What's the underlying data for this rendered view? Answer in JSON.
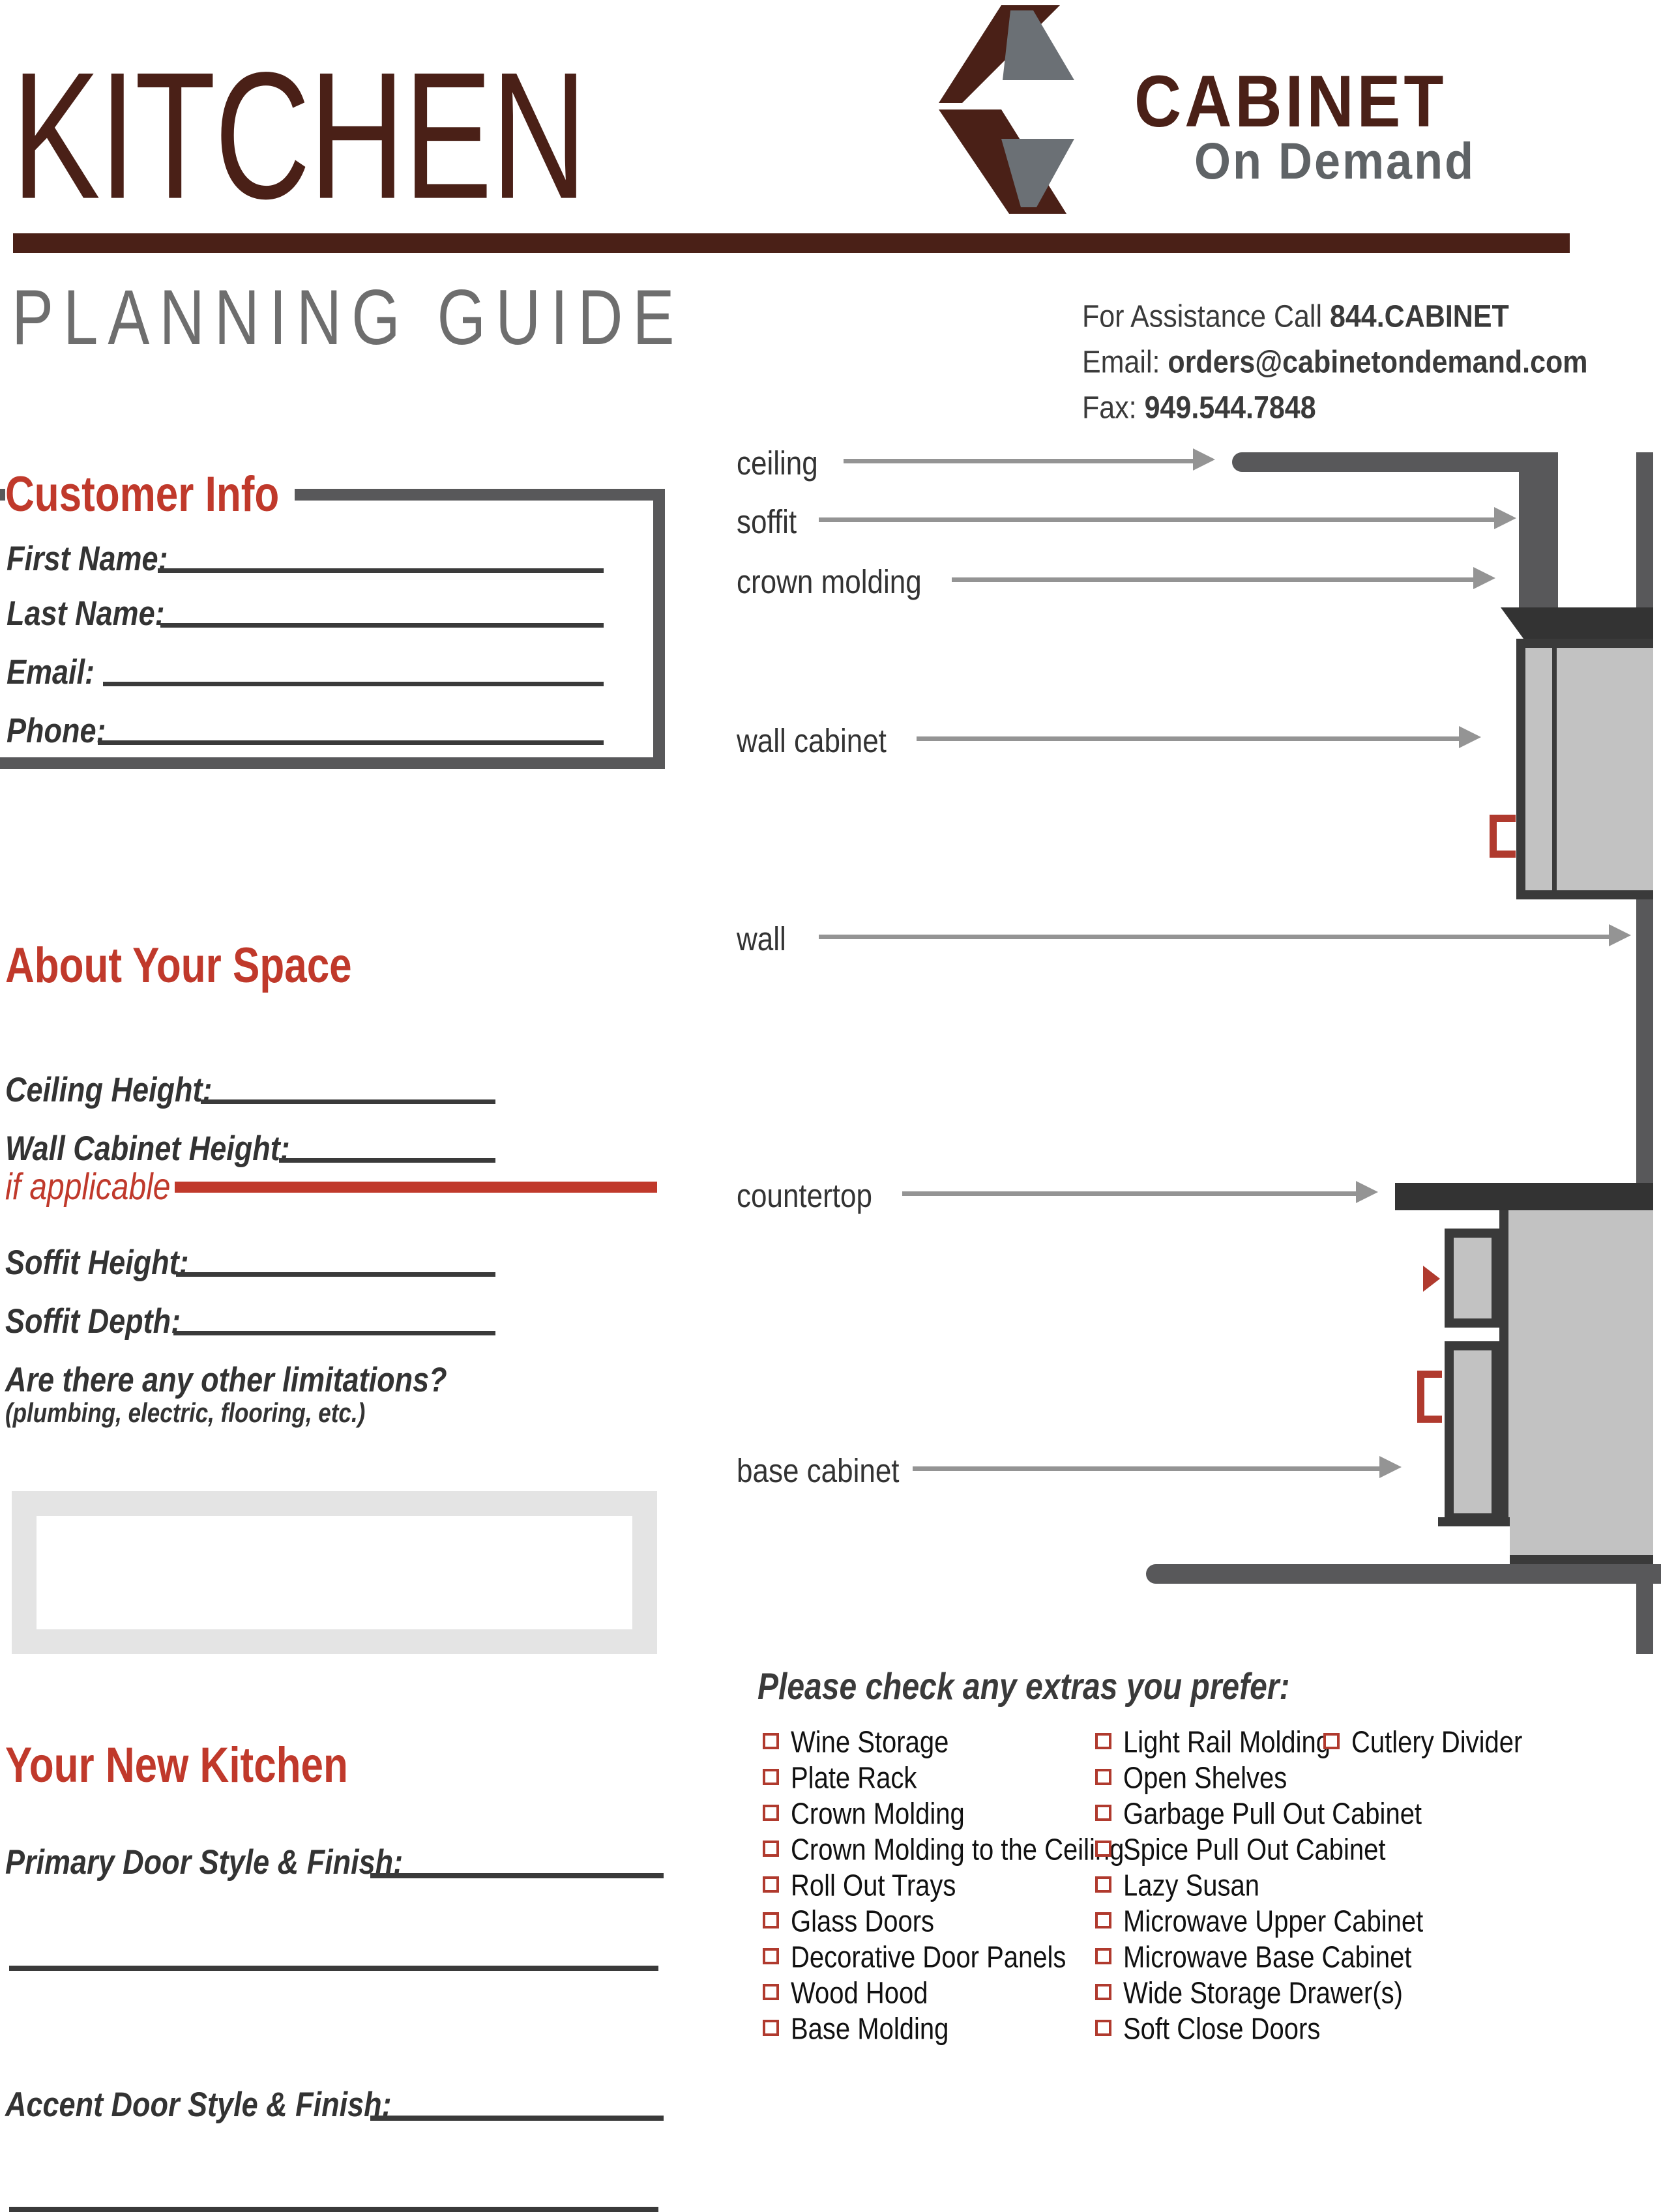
{
  "header": {
    "title": "KITCHEN",
    "subtitle": "PLANNING GUIDE",
    "logo": {
      "word_primary": "CABINET",
      "word_secondary": "On Demand"
    },
    "contact": {
      "phone_prefix": "For Assistance Call ",
      "phone": "844.CABINET",
      "email_prefix": "Email: ",
      "email": "orders@cabinetondemand.com",
      "fax_prefix": "Fax: ",
      "fax": "949.544.7848"
    }
  },
  "customer_info": {
    "heading": "Customer Info",
    "fields": [
      {
        "label": "First Name:",
        "value": ""
      },
      {
        "label": "Last Name:",
        "value": ""
      },
      {
        "label": "Email:",
        "value": ""
      },
      {
        "label": "Phone:",
        "value": ""
      }
    ]
  },
  "about_your_space": {
    "heading": "About Your Space",
    "fields": [
      {
        "label": "Ceiling Height:",
        "value": ""
      },
      {
        "label": "Wall Cabinet Height:",
        "value": ""
      },
      {
        "label": "Soffit Height:",
        "value": ""
      },
      {
        "label": "Soffit Depth:",
        "value": ""
      }
    ],
    "if_applicable_note": "if applicable",
    "limitations_question": "Are there any other limitations?",
    "limitations_hint": "(plumbing, electric, flooring, etc.)",
    "limitations_value": ""
  },
  "your_new_kitchen": {
    "heading": "Your New Kitchen",
    "fields": [
      {
        "label": "Primary Door Style & Finish:",
        "value": ""
      },
      {
        "label": "Accent Door Style & Finish:",
        "value": ""
      }
    ]
  },
  "diagram": {
    "labels": [
      "ceiling",
      "soffit",
      "crown molding",
      "wall cabinet",
      "wall",
      "countertop",
      "base cabinet"
    ]
  },
  "extras": {
    "heading": "Please check any extras you prefer:",
    "column1": [
      "Wine Storage",
      "Plate Rack",
      "Crown Molding",
      "Crown Molding to the Ceiling",
      "Roll Out Trays",
      "Glass Doors",
      "Decorative Door Panels",
      "Wood Hood",
      "Base Molding"
    ],
    "column2": [
      "Light Rail Molding",
      "Open Shelves",
      "Garbage Pull Out Cabinet",
      "Spice Pull Out Cabinet",
      "Lazy Susan",
      "Microwave Upper Cabinet",
      "Microwave Base Cabinet",
      "Wide Storage Drawer(s)",
      "Soft Close Doors"
    ],
    "column3": [
      "Cutlery Divider"
    ]
  },
  "colors": {
    "brand_brown": "#4A2017",
    "accent_red": "#C0392B",
    "handle_red": "#B03A2E",
    "gray_dark": "#58585A",
    "gray_mid": "#949494",
    "gray_light": "#C2C2C2",
    "text_dark": "#333333"
  }
}
